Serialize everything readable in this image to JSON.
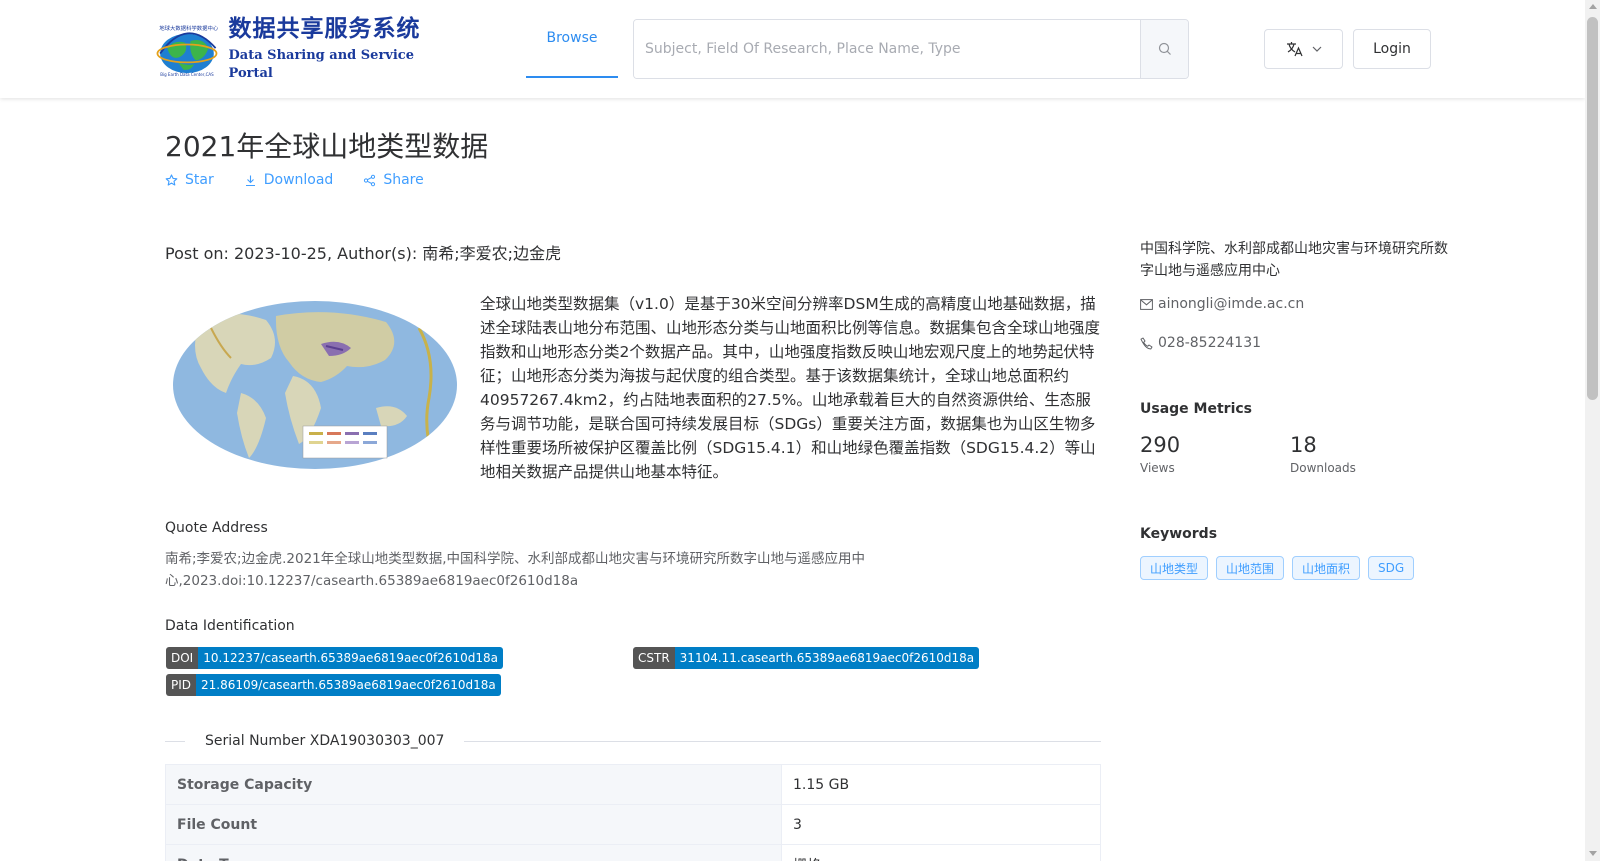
{
  "header": {
    "logo_cn": "数据共享服务系统",
    "logo_en": "Data Sharing and Service Portal",
    "nav_browse": "Browse",
    "search_placeholder": "Subject, Field Of Research, Place Name, Type",
    "login": "Login"
  },
  "dataset": {
    "title": "2021年全球山地类型数据",
    "actions": {
      "star": "Star",
      "download": "Download",
      "share": "Share"
    },
    "post_info": "Post on: 2023-10-25, Author(s): 南希;李爱农;边金虎",
    "description": "全球山地类型数据集（v1.0）是基于30米空间分辨率DSM生成的高精度山地基础数据，描述全球陆表山地分布范围、山地形态分类与山地面积比例等信息。数据集包含全球山地强度指数和山地形态分类2个数据产品。其中，山地强度指数反映山地宏观尺度上的地势起伏特征；山地形态分类为海拔与起伏度的组合类型。基于该数据集统计，全球山地总面积约40957267.4km2，约占陆地表面积的27.5%。山地承载着巨大的自然资源供给、生态服务与调节功能，是联合国可持续发展目标（SDGs）重要关注方面，数据集也为山区生物多样性重要场所被保护区覆盖比例（SDG15.4.1）和山地绿色覆盖指数（SDG15.4.2）等山地相关数据产品提供山地基本特征。",
    "quote_label": "Quote Address",
    "quote_text": "南希;李爱农;边金虎.2021年全球山地类型数据,中国科学院、水利部成都山地灾害与环境研究所数字山地与遥感应用中心,2023.doi:10.12237/casearth.65389ae6819aec0f2610d18a",
    "ident_label": "Data Identification",
    "identifiers": {
      "doi_key": "DOI",
      "doi_val": "10.12237/casearth.65389ae6819aec0f2610d18a",
      "cstr_key": "CSTR",
      "cstr_val": "31104.11.casearth.65389ae6819aec0f2610d18a",
      "pid_key": "PID",
      "pid_val": "21.86109/casearth.65389ae6819aec0f2610d18a"
    },
    "serial": "Serial Number XDA19030303_007",
    "table": [
      {
        "k": "Storage Capacity",
        "v": "1.15 GB"
      },
      {
        "k": "File Count",
        "v": "3"
      },
      {
        "k": "Data Type",
        "v": "栅格"
      }
    ]
  },
  "sidebar": {
    "org": "中国科学院、水利部成都山地灾害与环境研究所数字山地与遥感应用中心",
    "email": "ainongli@imde.ac.cn",
    "phone": "028-85224131",
    "metrics_title": "Usage Metrics",
    "views": "290",
    "views_label": "Views",
    "downloads": "18",
    "downloads_label": "Downloads",
    "keywords_title": "Keywords",
    "keywords": [
      "山地类型",
      "山地范围",
      "山地面积",
      "SDG"
    ]
  },
  "colors": {
    "primary": "#409eff",
    "brand": "#1a3a9c",
    "badge_key": "#555555",
    "badge_value": "#007ec6"
  }
}
